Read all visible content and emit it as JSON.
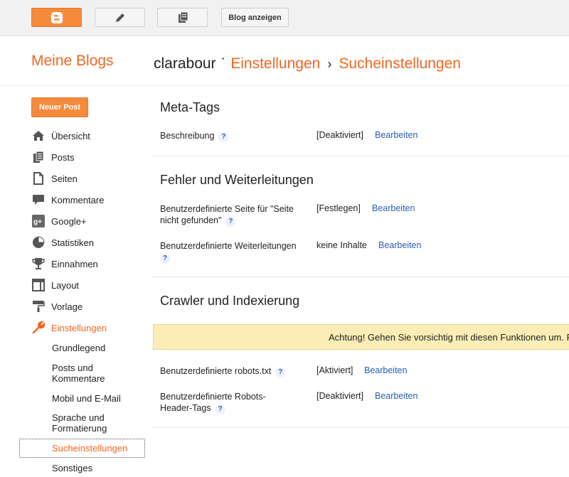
{
  "topbar": {
    "view_blog": "Blog anzeigen"
  },
  "header": {
    "my_blogs": "Meine Blogs",
    "blog_name": "clarabour",
    "dot": "·",
    "settings": "Einstellungen",
    "separator": "›",
    "search_settings": "Sucheinstellungen"
  },
  "sidebar": {
    "new_post": "Neuer Post",
    "items": [
      {
        "label": "Übersicht",
        "icon": "home-icon"
      },
      {
        "label": "Posts",
        "icon": "posts-icon"
      },
      {
        "label": "Seiten",
        "icon": "page-icon"
      },
      {
        "label": "Kommentare",
        "icon": "comment-icon"
      },
      {
        "label": "Google+",
        "icon": "googleplus-icon"
      },
      {
        "label": "Statistiken",
        "icon": "pie-chart-icon"
      },
      {
        "label": "Einnahmen",
        "icon": "trophy-icon"
      },
      {
        "label": "Layout",
        "icon": "layout-icon"
      },
      {
        "label": "Vorlage",
        "icon": "paint-roller-icon"
      },
      {
        "label": "Einstellungen",
        "icon": "wrench-icon"
      }
    ],
    "sub_items": [
      "Grundlegend",
      "Posts und Kommentare",
      "Mobil und E-Mail",
      "Sprache und Formatierung",
      "Sucheinstellungen",
      "Sonstiges"
    ],
    "colors": {
      "accent": "#f26522",
      "link": "#2a5db0"
    }
  },
  "main": {
    "meta_tags": {
      "title": "Meta-Tags",
      "description_label": "Beschreibung",
      "description_value": "[Deaktiviert]",
      "edit": "Bearbeiten"
    },
    "errors": {
      "title": "Fehler und Weiterleitungen",
      "not_found_label": "Benutzerdefinierte Seite für \"Seite nicht gefunden\"",
      "not_found_value": "[Festlegen]",
      "redirects_label": "Benutzerdefinierte Weiterleitungen",
      "redirects_value": "keine Inhalte",
      "edit": "Bearbeiten"
    },
    "crawler": {
      "title": "Crawler und Indexierung",
      "warning": "Achtung! Gehen Sie vorsichtig mit diesen Funktionen um. F",
      "robots_label": "Benutzerdefinierte robots.txt",
      "robots_value": "[Aktiviert]",
      "header_tags_label": "Benutzerdefinierte Robots-Header-Tags",
      "header_tags_value": "[Deaktiviert]",
      "edit": "Bearbeiten"
    },
    "help": "?"
  }
}
